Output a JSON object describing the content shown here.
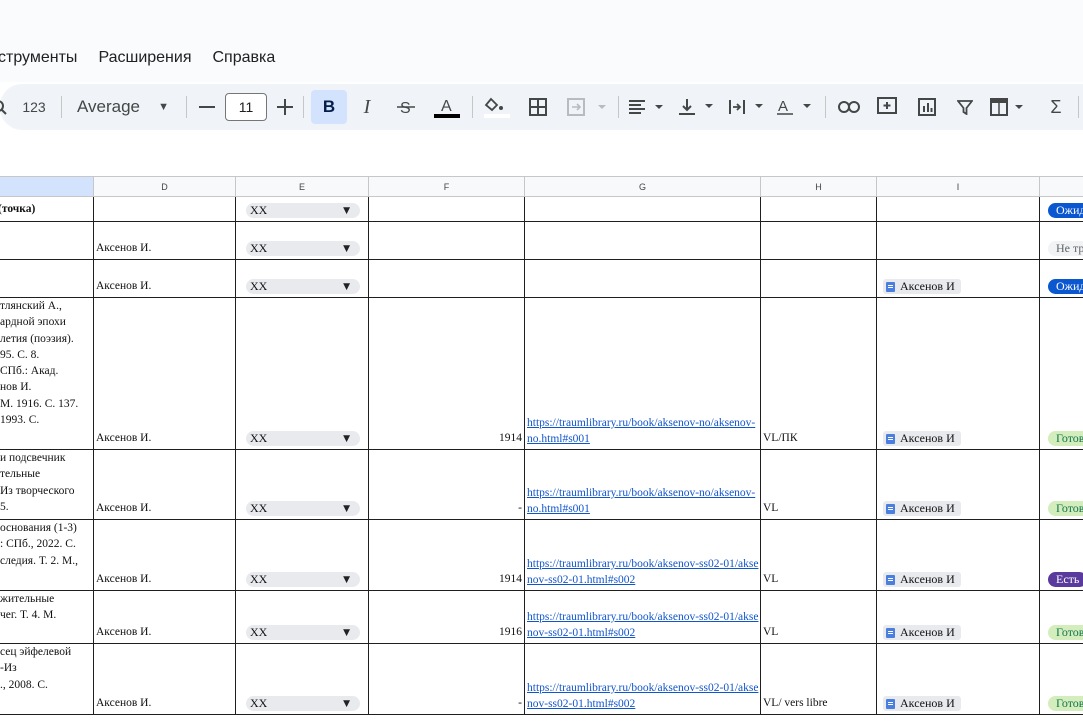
{
  "menu": [
    "струменты",
    "Расширения",
    "Справка"
  ],
  "toolbar": {
    "format_123": "123",
    "font": "Average",
    "font_size": "11",
    "bold": "B",
    "italic": "I",
    "sigma": "Σ"
  },
  "columns": [
    "D",
    "E",
    "F",
    "G",
    "H",
    "I"
  ],
  "rows": [
    {
      "c": "(точка)",
      "d": "",
      "e": "XX",
      "f": "",
      "g": "",
      "h": "",
      "i": "",
      "j": "Ожид",
      "jcolor": "#0b57d0",
      "jtext": "#ffffff"
    },
    {
      "c": "",
      "d": "Аксенов И.",
      "e": "XX",
      "f": "",
      "g": "",
      "h": "",
      "i": "",
      "j": "Не тр",
      "jcolor": "#f1f3f4",
      "jtext": "#5f6368"
    },
    {
      "c": "",
      "d": "Аксенов И.",
      "e": "XX",
      "f": "",
      "g": "",
      "h": "",
      "i": "Аксенов И",
      "j": "Ожид",
      "jcolor": "#0b57d0",
      "jtext": "#ffffff"
    },
    {
      "c": "тлянский А.,\nардной эпохи\nлетия (поэзия).\n95. С. 8.\nСПб.: Акад.\nнов И.\nМ. 1916. С. 137.\n1993. С.",
      "d": "Аксенов И.",
      "e": "XX",
      "f": "1914",
      "g": "https://traumlibrary.ru/book/aksenov-no/aksenov-no.html#s001",
      "h": "VL/ПК",
      "i": "Аксенов И",
      "j": "Готов",
      "jcolor": "#d4edbc",
      "jtext": "#11734b"
    },
    {
      "c": "и подсвечник\nтельные\nИз творческого\n5.",
      "d": "Аксенов И.",
      "e": "XX",
      "f": "-",
      "g": "https://traumlibrary.ru/book/aksenov-no/aksenov-no.html#s001",
      "h": "VL",
      "i": "Аксенов И",
      "j": "Готов",
      "jcolor": "#d4edbc",
      "jtext": "#11734b"
    },
    {
      "c": "основания (1-3)\n: СПб., 2022. С.\nследия. Т. 2. М.,",
      "d": "Аксенов И.",
      "e": "XX",
      "f": "1914",
      "g": "https://traumlibrary.ru/book/aksenov-ss02-01/aksenov-ss02-01.html#s002",
      "h": "VL",
      "i": "Аксенов И",
      "j": "Есть",
      "jcolor": "#5b3a9e",
      "jtext": "#ffffff"
    },
    {
      "c": "жительные\nчег. Т. 4. М.",
      "d": "Аксенов И.",
      "e": "XX",
      "f": "1916",
      "g": "https://traumlibrary.ru/book/aksenov-ss02-01/aksenov-ss02-01.html#s002",
      "h": "VL",
      "i": "Аксенов И",
      "j": "Готов",
      "jcolor": "#d4edbc",
      "jtext": "#11734b"
    },
    {
      "c": "сец эйфелевой\n-Из\n., 2008. С.",
      "d": "Аксенов И.",
      "e": "XX",
      "f": "-",
      "g": "https://traumlibrary.ru/book/aksenov-ss02-01/aksenov-ss02-01.html#s002",
      "h": "VL/ vers libre",
      "i": "Аксенов И",
      "j": "Готов",
      "jcolor": "#d4edbc",
      "jtext": "#11734b"
    }
  ]
}
